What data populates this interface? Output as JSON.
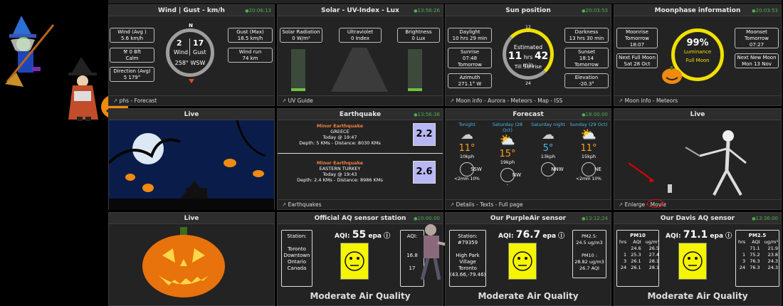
{
  "wind": {
    "title": "Wind | Gust - km/h",
    "time": "20:06:13",
    "avg": "Wind (Avg )",
    "avg_v": "5.6 km/h",
    "bft": "0 Bft",
    "bft_v": "Calm",
    "dir": "Direction (Avg)",
    "dir_v": "5 179°",
    "gust": "Gust (Max)",
    "gust_v": "18.5 km/h",
    "run": "Wind run",
    "run_v": "74 km",
    "n": "N",
    "w1": "2",
    "w2": "17",
    "lw": "Wind",
    "lg": "Gust",
    "deg": "258° WSW",
    "footer": "phs - Forecast"
  },
  "solar": {
    "title": "Solar - UV-Index - Lux",
    "time": "13:56:26",
    "rad": "Solar Radiation",
    "rad_v": "0 W/m²",
    "uv": "Ultraviolet",
    "uv_v": "0 Index",
    "br": "Brightness",
    "br_v": "0 Lux",
    "footer": "UV Guide"
  },
  "sun": {
    "title": "Sun position",
    "time": "20:03:53",
    "day": "Daylight",
    "day_v": "10 hrs 29 min",
    "rise": "Sunrise",
    "rise_t": "07:48",
    "rise_d": "Tomorrow",
    "az": "Azimuth",
    "az_v": "271.1° W",
    "dark": "Darkness",
    "dark_v": "13 hrs 30 min",
    "set": "Sunset",
    "set_t": "18:14",
    "set_d": "Tomorrow",
    "el": "Elevation",
    "el_v": "-20.3°",
    "c12": "12",
    "c24": "24",
    "est": "Estimated",
    "hrs": "11",
    "hrsl": "hrs",
    "min": "42",
    "minl": "min",
    "till": "Till Sunrise",
    "footer": "Moon info - Aurora - Meteors - Map - ISS"
  },
  "moon": {
    "title": "Moonphase information",
    "time": "20:03:53",
    "mr": "Moonrise",
    "mr_v": "Tomorrow",
    "mr_t": "18:07",
    "ms": "Moonset",
    "ms_v": "Tomorrow",
    "ms_t": "07:27",
    "nf": "Next Full Moon",
    "nf_v": "Sat 28 Oct",
    "nn": "Next New Moon",
    "nn_v": "Mon 13 Nov",
    "pct": "99%",
    "lum": "Luminance",
    "full": "Full Moon",
    "footer": "Moon info - Meteors"
  },
  "live1": {
    "title": "Live"
  },
  "quake": {
    "title": "Earthquake",
    "time": "13:56:38",
    "e1_t": "Minor Earthquake",
    "e1_p": "GREECE",
    "e1_w": "Today @ 19:47",
    "e1_d": "Depth: 5 KMs - Distance: 8030 KMs",
    "e1_m": "2.2",
    "e2_t": "Minor Earthquake",
    "e2_p": "EASTERN TURKEY",
    "e2_w": "Today @ 19:43",
    "e2_d": "Depth: 2.4 KMs - Distance: 8986 KMs",
    "e2_m": "2.6",
    "footer": "Earthquakes"
  },
  "forecast": {
    "title": "Forecast",
    "time": "18:00:00",
    "footer": "Details - Texts - Full page",
    "cols": [
      {
        "day": "Tonight",
        "temp": "11°",
        "wind": "10kph",
        "dir": "SSW",
        "rain": "<2mm 10%"
      },
      {
        "day": "Saturday (28 Oct)",
        "temp": "15°",
        "wind": "19kph",
        "dir": "NW",
        "rain": "-"
      },
      {
        "day": "Saturday night",
        "temp": "5°",
        "wind": "13kph",
        "dir": "NNW",
        "rain": "-"
      },
      {
        "day": "Sunday (29 Oct)",
        "temp": "11°",
        "wind": "15kph",
        "dir": "NE",
        "rain": "<2mm 10%"
      }
    ]
  },
  "live2": {
    "title": "Live",
    "footer": "Enlarge - Movie"
  },
  "live3": {
    "title": "Live"
  },
  "aq1": {
    "title": "Official AQ sensor station",
    "time": "10:00:00",
    "st": "Station:",
    "st1": "Toronto",
    "st2": "Downtown",
    "st3": "Ontario",
    "st4": "Canada",
    "aqi": "AQI:",
    "aqi_v": "55",
    "epa": "epa",
    "aqi2": "AQI:",
    "p1": "16.8",
    "p2": "17",
    "q": "Moderate Air Quality"
  },
  "aq2": {
    "title": "Our PurpleAir sensor",
    "time": "13:12:24",
    "st": "Station:",
    "st1": "#79359",
    "st2": "High Park",
    "st3": "Village",
    "st4": "Toronto",
    "st5": "(43.66,-79.46)",
    "aqi": "AQI:",
    "aqi_v": "76.7",
    "epa": "epa",
    "pm25": "PM2.5:",
    "pm25_v": "24.5 ug/m3",
    "pm10": "PM10 :",
    "pm10_v": "28.82 ug/m3",
    "pm10_a": "26.7 AQI",
    "q": "Moderate Air Quality"
  },
  "aq3": {
    "title": "Our Davis AQ sensor",
    "time": "13:36:00",
    "pm10": "PM10",
    "pm25": "PM2.5",
    "aqi": "AQI:",
    "aqi_v": "71.1",
    "epa": "epa",
    "h1": "hrs",
    "h2": "AQI",
    "h3": "ug/m³",
    "q": "Moderate Air Quality",
    "t1": [
      [
        "",
        "24.6",
        "26.5"
      ],
      [
        "1",
        "25.3",
        "27.4"
      ],
      [
        "3",
        "26.1",
        "28.1"
      ],
      [
        "24",
        "26.1",
        "28.1"
      ]
    ],
    "t2": [
      [
        "",
        "71.1",
        "21.9"
      ],
      [
        "1",
        "75.2",
        "23.8"
      ],
      [
        "3",
        "76.3",
        "24.3"
      ],
      [
        "24",
        "76.3",
        "24.3"
      ]
    ]
  }
}
